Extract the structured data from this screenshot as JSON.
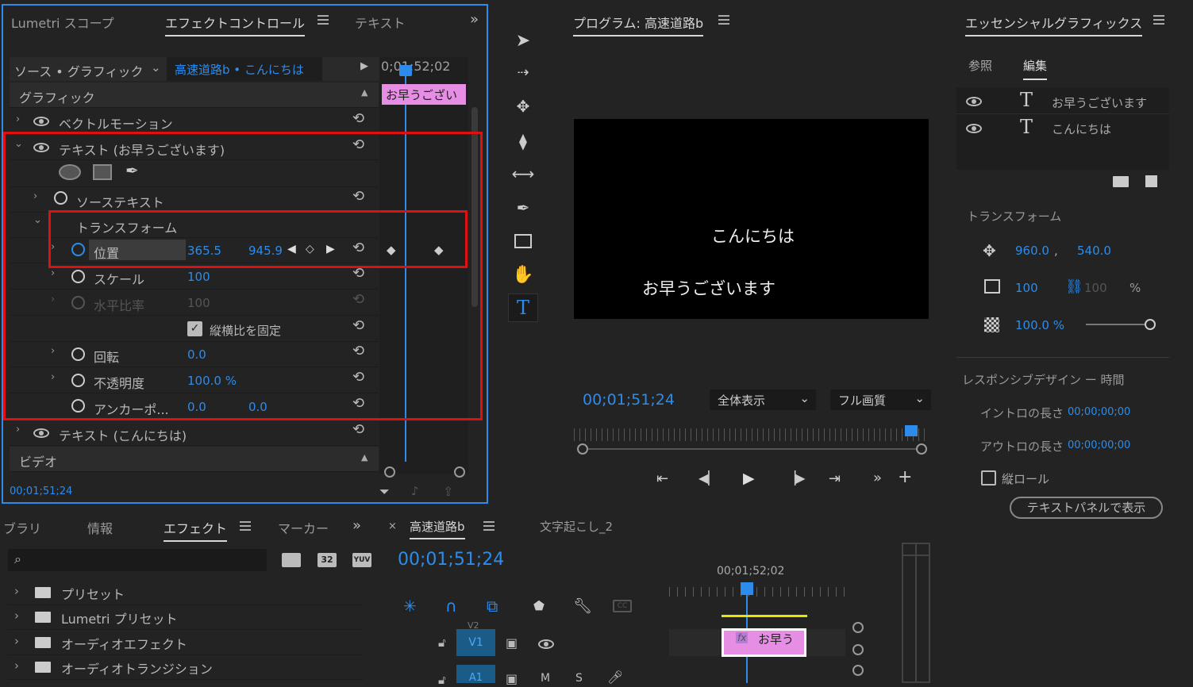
{
  "effect_panel": {
    "tabs": [
      "Lumetri スコープ",
      "エフェクトコントロール",
      "テキスト"
    ],
    "source_label": "ソース • グラフィック",
    "clip_label": "高速道路b • こんにちは",
    "timecode_head": "0;01;52;02",
    "clip_bar_label": "お早うござい",
    "section_graphic": "グラフィック",
    "vector_motion": "ベクトルモーション",
    "text_layer1": "テキスト (お早うございます)",
    "source_text": "ソーステキスト",
    "transform": "トランスフォーム",
    "position_label": "位置",
    "position_x": "365.5",
    "position_y": "945.9",
    "scale_label": "スケール",
    "scale_value": "100",
    "scale_h_label": "水平比率",
    "scale_h_value": "100",
    "lock_ratio_label": "縦横比を固定",
    "rotation_label": "回転",
    "rotation_value": "0.0",
    "opacity_label": "不透明度",
    "opacity_value": "100.0 %",
    "anchor_label": "アンカーポ...",
    "anchor_x": "0.0",
    "anchor_y": "0.0",
    "text_layer2": "テキスト (こんにちは)",
    "section_video": "ビデオ",
    "footer_timecode": "00;01;51;24"
  },
  "program": {
    "title": "プログラム: 高速道路b",
    "line1": "こんにちは",
    "line2": "お早うございます",
    "timecode": "00;01;51;24",
    "zoom_select": "全体表示",
    "quality_select": "フル画質"
  },
  "essential": {
    "title": "エッセンシャルグラフィックス",
    "tab_browse": "参照",
    "tab_edit": "編集",
    "layers": [
      "お早うございます",
      "こんにちは"
    ],
    "transform_label": "トランスフォーム",
    "pos_x": "960.0",
    "pos_sep": ",",
    "pos_y": "540.0",
    "scale": "100",
    "scale_h": "100",
    "scale_unit": "%",
    "opacity": "100.0 %",
    "opacity_slider": 1.0,
    "responsive_label": "レスポンシブデザイン ー 時間",
    "intro_label": "イントロの長さ",
    "intro_value": "00;00;00;00",
    "outro_label": "アウトロの長さ",
    "outro_value": "00;00;00;00",
    "roll_label": "縦ロール",
    "text_panel_button": "テキストパネルで表示"
  },
  "effects_bin": {
    "tabs": [
      "ブラリ",
      "情報",
      "エフェクト",
      "マーカー"
    ],
    "items": [
      "プリセット",
      "Lumetri プリセット",
      "オーディオエフェクト",
      "オーディオトランジション"
    ],
    "icon_labels": [
      "32",
      "YUV"
    ]
  },
  "timeline": {
    "seq_tab": "高速道路b",
    "seq_tab2": "文字起こし_2",
    "timecode": "00;01;51;24",
    "ruler_time": "00;01;52;02",
    "track_v2": "V2",
    "track_v1": "V1",
    "track_a1": "A1",
    "track_m": "M",
    "track_s": "S",
    "clip_label": "お早う",
    "clip_fx": "fx"
  },
  "colors": {
    "accent": "#2d8ceb",
    "clip_pink": "#e58ee3",
    "highlight_red": "#e01010"
  }
}
